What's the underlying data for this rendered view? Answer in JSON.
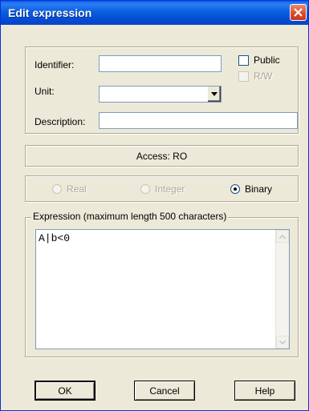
{
  "window": {
    "title": "Edit expression",
    "close_icon": "close-icon"
  },
  "identity": {
    "identifier_label": "Identifier:",
    "identifier_value": "",
    "public_label": "Public",
    "public_checked": false,
    "rw_label": "R/W",
    "rw_checked": false,
    "rw_enabled": false,
    "unit_label": "Unit:",
    "unit_value": "",
    "description_label": "Description:",
    "description_value": ""
  },
  "access": {
    "text": "Access: RO"
  },
  "types": {
    "options": [
      {
        "label": "Real",
        "selected": false,
        "enabled": false
      },
      {
        "label": "Integer",
        "selected": false,
        "enabled": false
      },
      {
        "label": "Binary",
        "selected": true,
        "enabled": true
      }
    ]
  },
  "expression": {
    "group_title": "Expression (maximum length 500 characters)",
    "value": "A|b<0"
  },
  "buttons": {
    "ok": "OK",
    "cancel": "Cancel",
    "help": "Help"
  }
}
